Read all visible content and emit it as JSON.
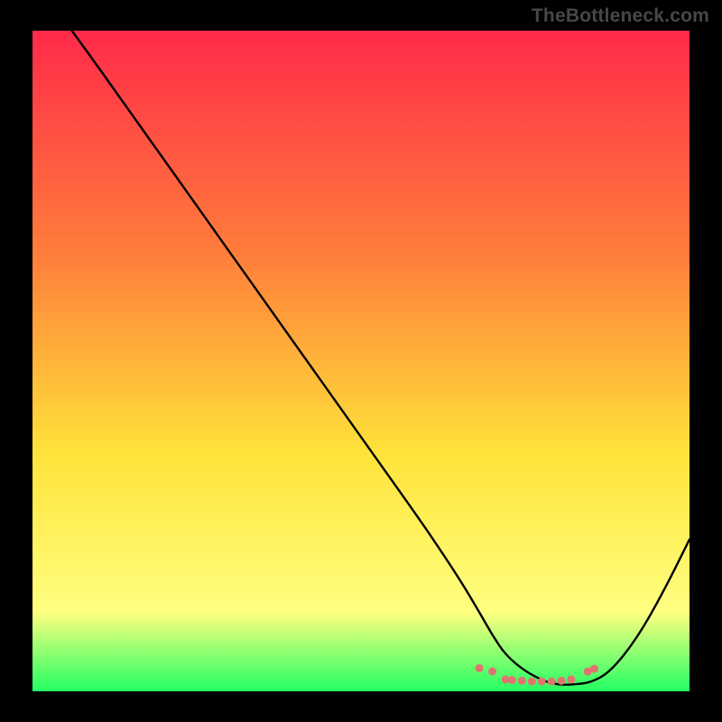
{
  "watermark": "TheBottleneck.com",
  "colors": {
    "black": "#000000",
    "grad_top": "#ff2a49",
    "grad_mid1": "#ff7e3b",
    "grad_mid2": "#ffe33a",
    "grad_low": "#ffff80",
    "grad_bottom": "#22ff63",
    "curve": "#000000",
    "markers": "#e07570"
  },
  "chart_data": {
    "type": "line",
    "title": "",
    "xlabel": "",
    "ylabel": "",
    "xlim": [
      0,
      100
    ],
    "ylim": [
      0,
      100
    ],
    "x": [
      6,
      10,
      15,
      20,
      25,
      30,
      35,
      40,
      45,
      50,
      55,
      60,
      65,
      68,
      70,
      72,
      75,
      78,
      80,
      82,
      85,
      88,
      92,
      96,
      100
    ],
    "y": [
      100,
      94.5,
      87.5,
      80.5,
      73.5,
      66.5,
      59.5,
      52.5,
      45.5,
      38.5,
      31.5,
      24.5,
      17,
      12,
      8.5,
      5.5,
      3,
      1.5,
      1,
      1,
      1.3,
      3,
      8,
      15,
      23
    ],
    "flat_region": {
      "x_start": 68,
      "x_end": 85,
      "y": 2
    },
    "marker_points": [
      {
        "x": 68,
        "y": 3.5
      },
      {
        "x": 70,
        "y": 3.0
      },
      {
        "x": 72,
        "y": 1.8
      },
      {
        "x": 73,
        "y": 1.7
      },
      {
        "x": 74.5,
        "y": 1.6
      },
      {
        "x": 76,
        "y": 1.5
      },
      {
        "x": 77.5,
        "y": 1.5
      },
      {
        "x": 79,
        "y": 1.5
      },
      {
        "x": 80.5,
        "y": 1.6
      },
      {
        "x": 82,
        "y": 1.8
      },
      {
        "x": 84.5,
        "y": 3.0
      },
      {
        "x": 85.5,
        "y": 3.4
      }
    ]
  }
}
